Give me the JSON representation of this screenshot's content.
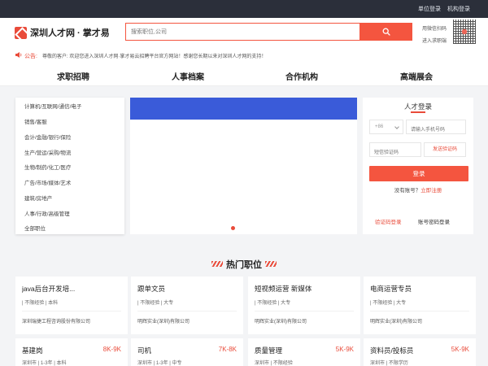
{
  "topbar": {
    "links": [
      "单位登录",
      "机构登录"
    ]
  },
  "header": {
    "logo_text": "深圳人才网 · 掌才易",
    "search_placeholder": "搜索职位,公司",
    "mini_links": [
      "用微信扫码",
      "进入求职端"
    ]
  },
  "notice": {
    "label": "公告:",
    "text": "尊敬的客户: 欢迎您进入深圳人才网·掌才易云招聘平台官方网站！感谢您长期以来对深圳人才网的支持！"
  },
  "nav": [
    "求职招聘",
    "人事档案",
    "合作机构",
    "高端展会"
  ],
  "categories": [
    "计算机/互联网/通信/电子",
    "销售/客服",
    "会计/金融/银行/保险",
    "生产/营运/采购/物流",
    "生物/制药/化工/医疗",
    "广告/市场/媒体/艺术",
    "建筑/房地产",
    "人事/行政/高级管理",
    "全部职位"
  ],
  "login": {
    "title": "人才登录",
    "country_code": "+86",
    "phone_placeholder": "请输入手机号码",
    "code_placeholder": "短信验证码",
    "send_code": "发送验证码",
    "submit": "登录",
    "no_account": "没有账号？",
    "register": "立即注册",
    "tabs": [
      "验证码登录",
      "账号密码登录"
    ]
  },
  "hot_jobs": {
    "title": "热门职位",
    "row1": [
      {
        "title": "java后台开发培...",
        "salary": "",
        "tags": "| 不限经验 | 本科",
        "company": "深圳瑞捷工程咨询股份有限公司"
      },
      {
        "title": "跟单文员",
        "salary": "",
        "tags": "| 不限经验 | 大专",
        "company": "明辉实业(深圳)有限公司"
      },
      {
        "title": "短视频运营 新媒体",
        "salary": "",
        "tags": "| 不限经验 | 大专",
        "company": "明辉实业(深圳)有限公司"
      },
      {
        "title": "电商运营专员",
        "salary": "",
        "tags": "| 不限经验 | 大专",
        "company": "明辉实业(深圳)有限公司"
      }
    ],
    "row2": [
      {
        "title": "基建岗",
        "salary": "8K-9K",
        "tags": "深圳市 | 1-3年 | 本科"
      },
      {
        "title": "司机",
        "salary": "7K-8K",
        "tags": "深圳市 | 1-3年 | 中专"
      },
      {
        "title": "质量管理",
        "salary": "5K-9K",
        "tags": "深圳市 | 不限经验"
      },
      {
        "title": "资料员/投标员",
        "salary": "5K-9K",
        "tags": "深圳市 | 不限学历"
      }
    ]
  },
  "colors": {
    "accent": "#f4553f",
    "banner": "#3a5bd9",
    "topbar": "#2b2f3a"
  },
  "icons": [
    "logo-icon",
    "search-icon",
    "horn-icon",
    "qr-code-icon",
    "chevron-down-icon"
  ]
}
